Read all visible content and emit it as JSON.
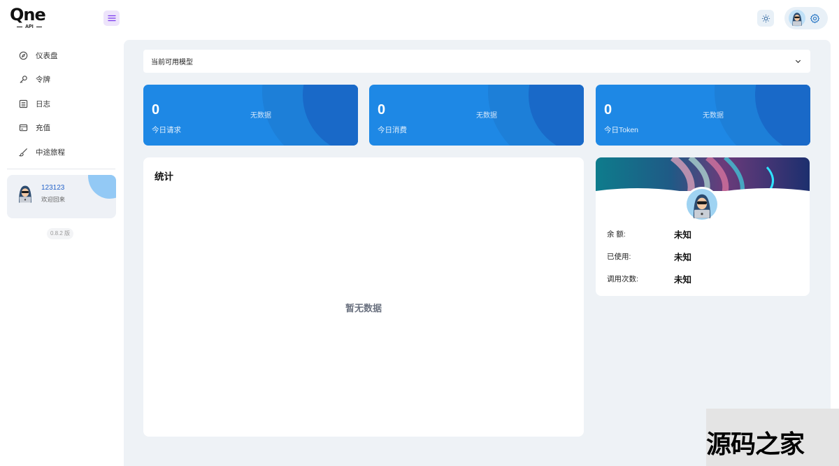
{
  "brand": {
    "name": "Qne",
    "sub": "API"
  },
  "nav": {
    "items": [
      {
        "label": "仪表盘",
        "icon": "dashboard-icon"
      },
      {
        "label": "令牌",
        "icon": "key-icon"
      },
      {
        "label": "日志",
        "icon": "log-icon"
      },
      {
        "label": "充值",
        "icon": "card-icon"
      },
      {
        "label": "中途旅程",
        "icon": "brush-icon"
      }
    ]
  },
  "user": {
    "name": "123123",
    "welcome": "欢迎回来"
  },
  "version": "0.8.2 版",
  "models": {
    "placeholder": "当前可用模型"
  },
  "stats": [
    {
      "value": "0",
      "label": "今日请求",
      "status": "无数据"
    },
    {
      "value": "0",
      "label": "今日消费",
      "status": "无数据"
    },
    {
      "value": "0",
      "label": "今日Token",
      "status": "无数据"
    }
  ],
  "statistics": {
    "title": "统计",
    "empty": "暂无数据"
  },
  "profile": {
    "rows": [
      {
        "key": "余 额:",
        "value": "未知"
      },
      {
        "key": "已使用:",
        "value": "未知"
      },
      {
        "key": "调用次数:",
        "value": "未知"
      }
    ]
  },
  "watermark": "源码之家",
  "colors": {
    "accent": "#1e88e5",
    "background": "#eef2f6",
    "link": "#2563c9"
  }
}
